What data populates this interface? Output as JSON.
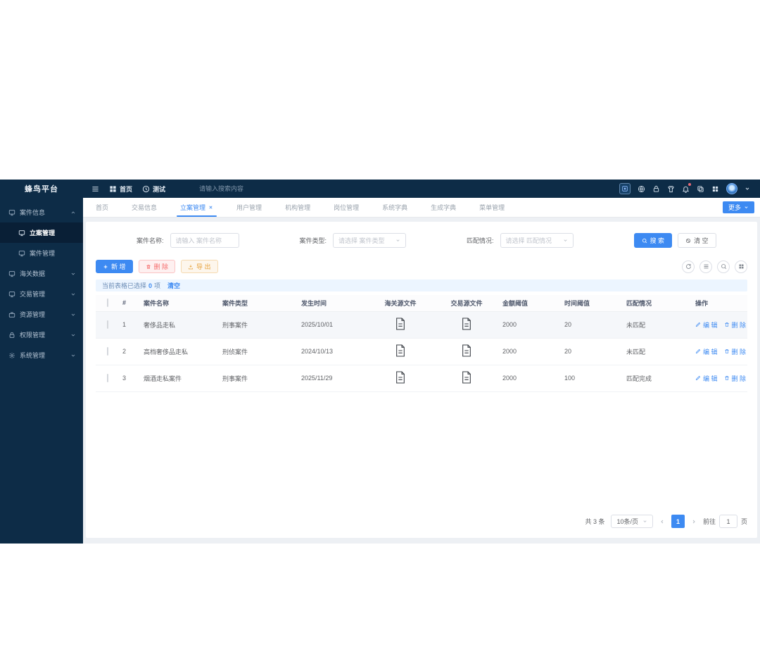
{
  "app": {
    "title": "蜂鸟平台"
  },
  "topbar": {
    "nav": [
      {
        "label": "首页"
      },
      {
        "label": "测试"
      }
    ],
    "search": {
      "placeholder": "请输入搜索内容"
    },
    "right_icons": [
      "screen-frame-icon",
      "globe-icon",
      "lock-icon",
      "theme-skin-icon",
      "bell-icon",
      "copy-docs-icon",
      "apps-grid-icon",
      "user-avatar",
      "chevron-down-icon"
    ]
  },
  "sidebar": {
    "groups": [
      {
        "label": "案件信息",
        "expanded": true,
        "children": [
          {
            "label": "立案管理",
            "active": true
          },
          {
            "label": "案件管理"
          }
        ]
      },
      {
        "label": "海关数据"
      },
      {
        "label": "交易管理"
      },
      {
        "label": "资源管理"
      },
      {
        "label": "权限管理"
      },
      {
        "label": "系统管理"
      }
    ]
  },
  "tabs": {
    "items": [
      {
        "label": "首页"
      },
      {
        "label": "交易信息"
      },
      {
        "label": "立案管理",
        "active": true,
        "closable": true
      },
      {
        "label": "用户管理"
      },
      {
        "label": "机构管理"
      },
      {
        "label": "岗位管理"
      },
      {
        "label": "系统字典"
      },
      {
        "label": "生成字典"
      },
      {
        "label": "菜单管理"
      }
    ],
    "more_label": "更多"
  },
  "filter": {
    "fields": [
      {
        "label": "案件名称:",
        "placeholder": "请输入 案件名称",
        "type": "input"
      },
      {
        "label": "案件类型:",
        "placeholder": "请选择 案件类型",
        "type": "select"
      },
      {
        "label": "匹配情况:",
        "placeholder": "请选择 匹配情况",
        "type": "select"
      }
    ],
    "search_label": "搜 索",
    "clear_label": "清 空"
  },
  "toolbar": {
    "add_label": "新 增",
    "delete_label": "删 除",
    "export_label": "导 出"
  },
  "selection_bar": {
    "prefix": "当前表格已选择",
    "count": "0",
    "suffix": "项",
    "clear_label": "清空"
  },
  "table": {
    "columns": [
      "",
      "#",
      "案件名称",
      "案件类型",
      "发生时间",
      "海关源文件",
      "交易源文件",
      "金额阈值",
      "时间阈值",
      "匹配情况",
      "操作"
    ],
    "rows": [
      {
        "index": "1",
        "name": "奢侈品走私",
        "type": "刑事案件",
        "date": "2025/10/01",
        "amount": "2000",
        "time_threshold": "20",
        "match_status": "未匹配"
      },
      {
        "index": "2",
        "name": "高档奢侈品走私",
        "type": "刑侦案件",
        "date": "2024/10/13",
        "amount": "2000",
        "time_threshold": "20",
        "match_status": "未匹配"
      },
      {
        "index": "3",
        "name": "烟酒走私案件",
        "type": "刑事案件",
        "date": "2025/11/29",
        "amount": "2000",
        "time_threshold": "100",
        "match_status": "匹配完成"
      }
    ],
    "edit_label": "编 辑",
    "delete_label": "删 除"
  },
  "pagination": {
    "total": "共 3 条",
    "page_size": "10条/页",
    "current_page": "1",
    "goto_label": "前往",
    "goto_value": "1",
    "page_label": "页"
  },
  "colors": {
    "accent": "#3d8af2",
    "dark_navy": "#0d2c47",
    "danger": "#f56c6c",
    "warning": "#e6a23c",
    "selection_bg": "#ecf5ff"
  }
}
